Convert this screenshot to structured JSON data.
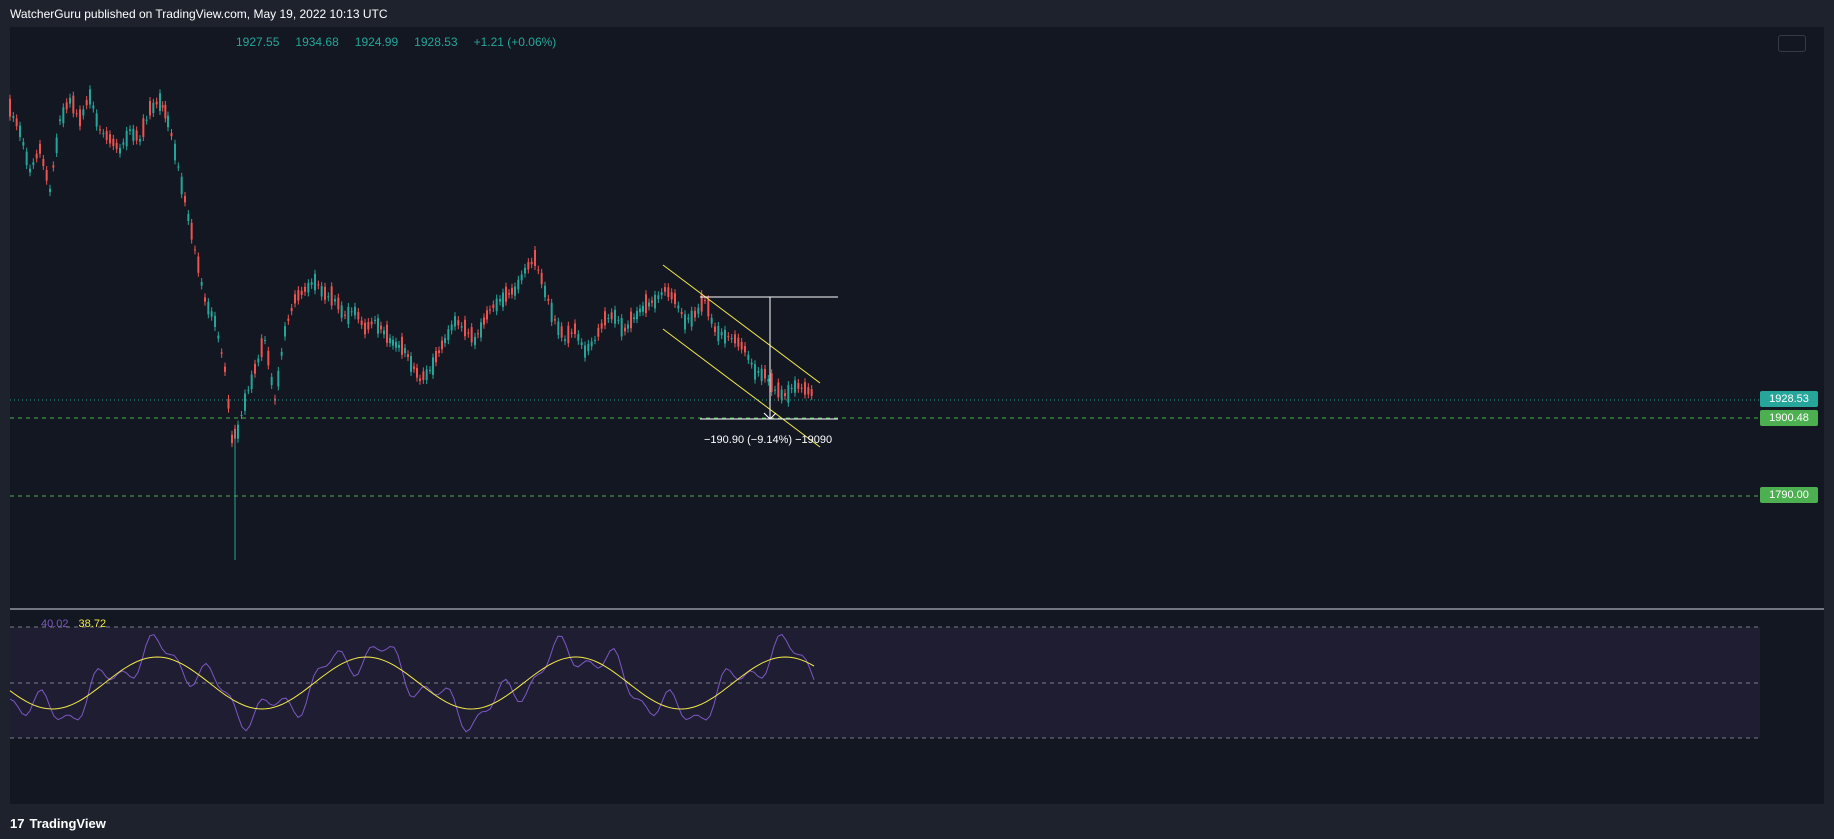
{
  "header": {
    "publisher_text": "WatcherGuru published on TradingView.com, May 19, 2022 10:13 UTC"
  },
  "ohlc": {
    "open": "1927.55",
    "high": "1934.68",
    "low": "1924.99",
    "close": "1928.53",
    "change": "+1.21 (+0.06%)"
  },
  "price_labels": {
    "current": "1928.53",
    "support_1": "1900.48",
    "support_2": "1790.00"
  },
  "colors": {
    "up": "#26a69a",
    "down": "#ef5350",
    "channel": "#f5e94b",
    "rsi": "#7e57c2",
    "rsi_ma": "#f5e94b",
    "current_price": "#26a69a",
    "support": "#4caf50"
  },
  "measure": {
    "text": "−190.90 (−9.14%) −19090"
  },
  "rsi": {
    "value": "40.02",
    "ma_value": "38.72"
  },
  "footer": {
    "brand": "TradingView",
    "logo_text": "17"
  }
}
